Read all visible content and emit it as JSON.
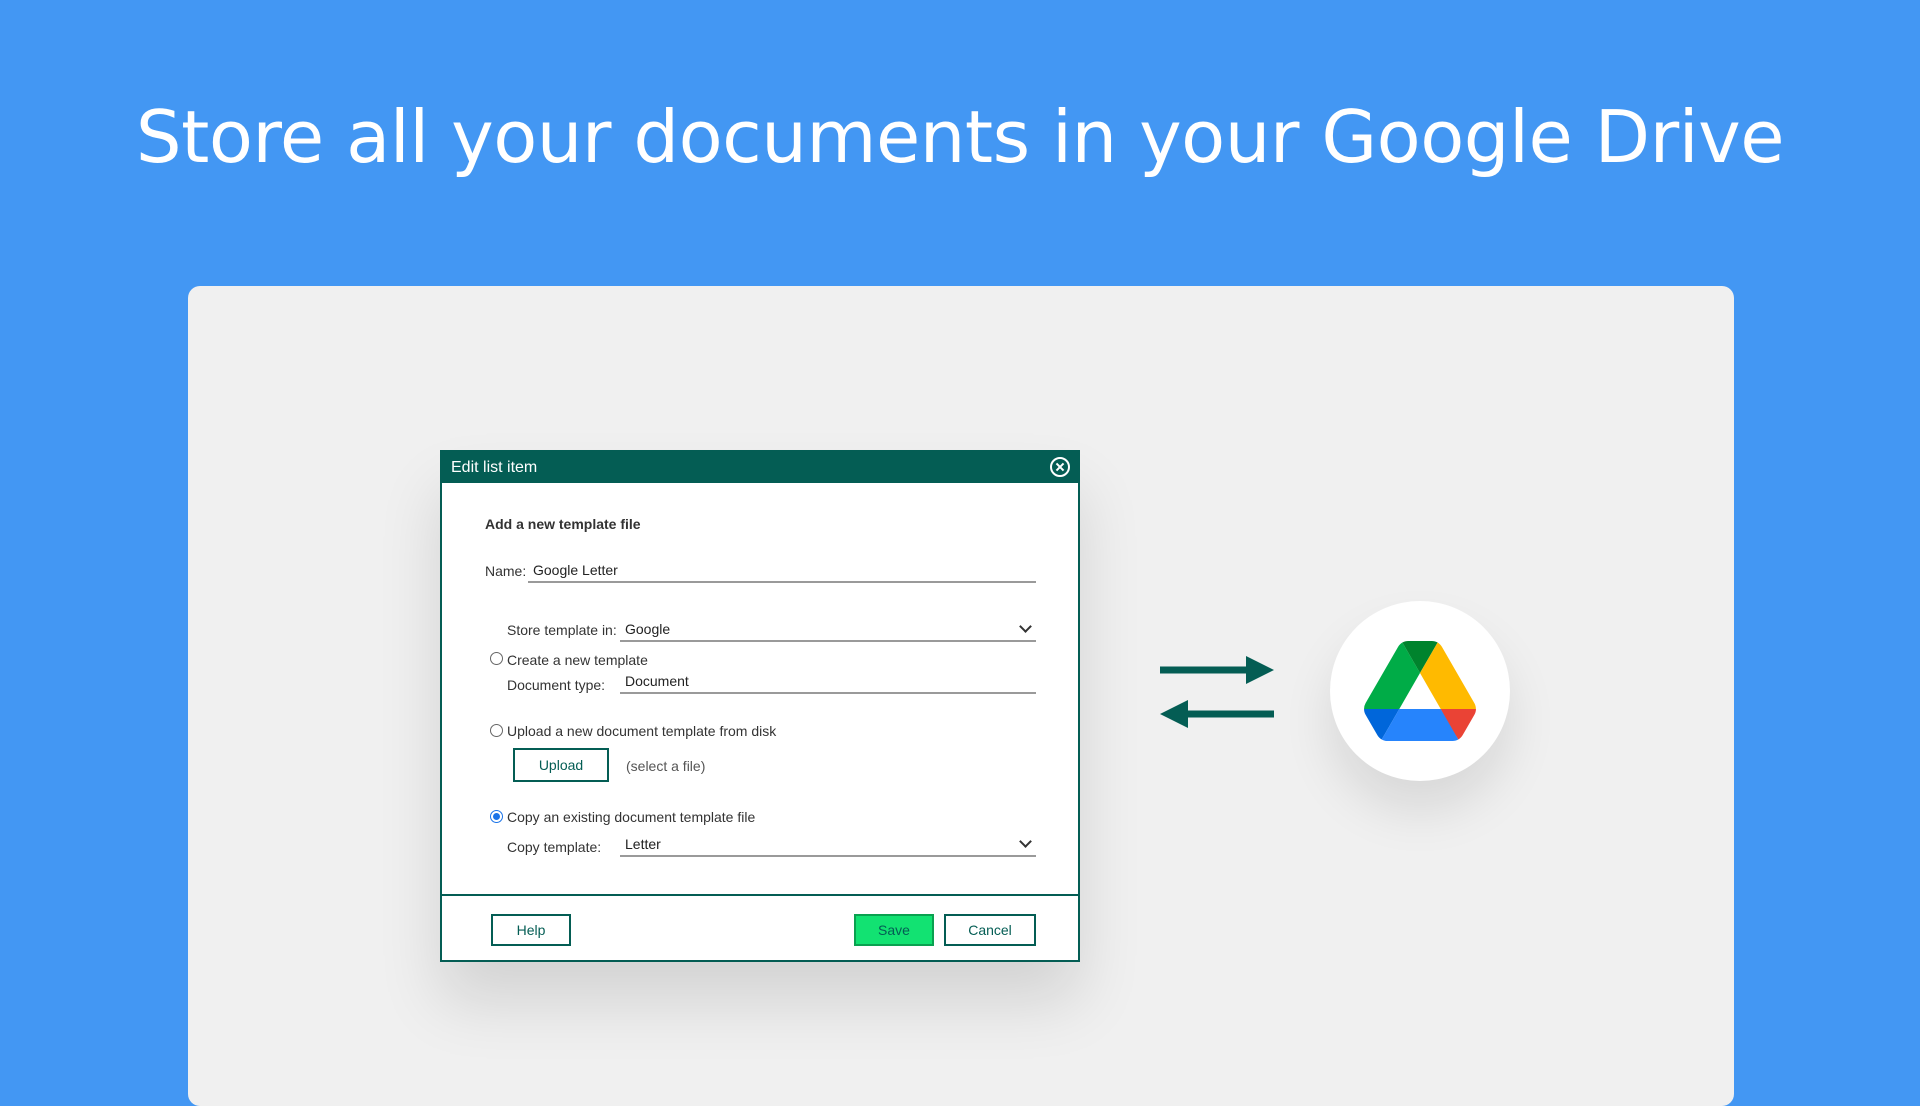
{
  "headline": "Store all your documents in your Google Drive",
  "dialog": {
    "title": "Edit list item",
    "section_title": "Add a new template file",
    "name_label": "Name:",
    "name_value": "Google Letter",
    "store_label": "Store template in:",
    "store_value": "Google",
    "create_new_label": "Create a new template",
    "doc_type_label": "Document type:",
    "doc_type_value": "Document",
    "upload_label": "Upload a new document template from disk",
    "upload_button": "Upload",
    "select_file_hint": "(select a file)",
    "copy_existing_label": "Copy an existing document template file",
    "copy_template_label": "Copy template:",
    "copy_template_value": "Letter",
    "help_button": "Help",
    "save_button": "Save",
    "cancel_button": "Cancel"
  },
  "colors": {
    "background": "#4397f3",
    "dialog_accent": "#045d54",
    "save_button": "#12e272"
  },
  "icons": [
    "close-icon",
    "chevron-down-icon",
    "sync-arrows-icon",
    "google-drive-icon"
  ]
}
